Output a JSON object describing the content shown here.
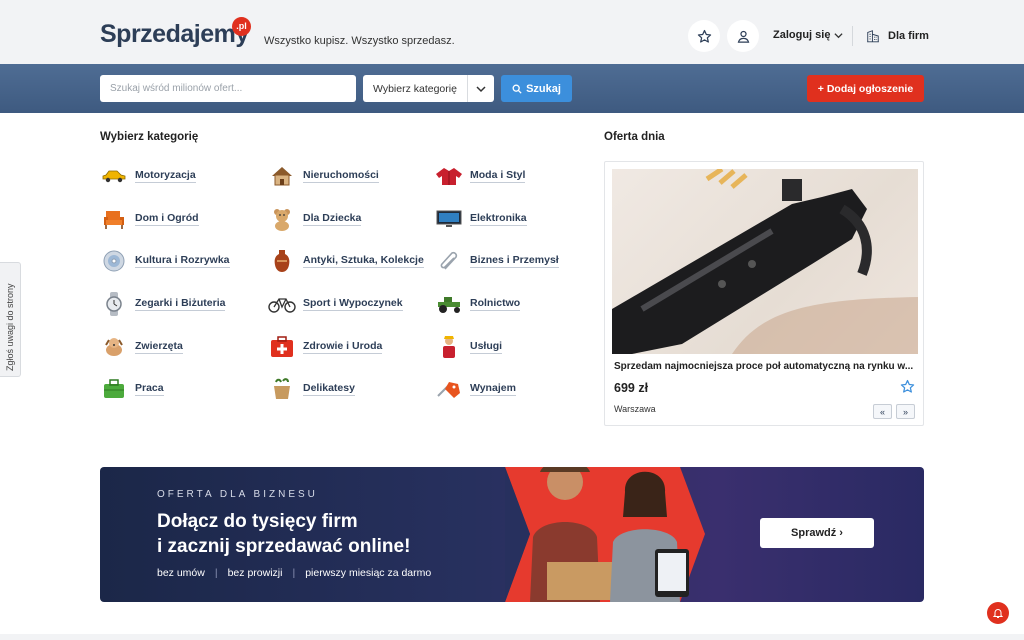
{
  "header": {
    "logo_text": "Sprzedajemy",
    "logo_badge": ".pl",
    "tagline": "Wszystko kupisz. Wszystko sprzedasz.",
    "login_label": "Zaloguj się",
    "firms_label": "Dla firm"
  },
  "search": {
    "placeholder": "Szukaj wśród milionów ofert...",
    "category_label": "Wybierz kategorię",
    "button_label": "Szukaj",
    "add_label": "+ Dodaj ogłoszenie"
  },
  "categories": {
    "title": "Wybierz kategorię",
    "items": [
      {
        "label": "Motoryzacja",
        "icon": "car-icon"
      },
      {
        "label": "Nieruchomości",
        "icon": "house-icon"
      },
      {
        "label": "Moda i Styl",
        "icon": "jacket-icon"
      },
      {
        "label": "Dom i Ogród",
        "icon": "armchair-icon"
      },
      {
        "label": "Dla Dziecka",
        "icon": "teddy-bear-icon"
      },
      {
        "label": "Elektronika",
        "icon": "tv-icon"
      },
      {
        "label": "Kultura i Rozrywka",
        "icon": "disc-icon"
      },
      {
        "label": "Antyki, Sztuka, Kolekcje",
        "icon": "vase-icon"
      },
      {
        "label": "Biznes i Przemysł",
        "icon": "paperclip-icon"
      },
      {
        "label": "Zegarki i Biżuteria",
        "icon": "watch-icon"
      },
      {
        "label": "Sport i Wypoczynek",
        "icon": "bicycle-icon"
      },
      {
        "label": "Rolnictwo",
        "icon": "tractor-icon"
      },
      {
        "label": "Zwierzęta",
        "icon": "dog-icon"
      },
      {
        "label": "Zdrowie i Uroda",
        "icon": "first-aid-icon"
      },
      {
        "label": "Usługi",
        "icon": "worker-icon"
      },
      {
        "label": "Praca",
        "icon": "briefcase-icon"
      },
      {
        "label": "Delikatesy",
        "icon": "grocery-bag-icon"
      },
      {
        "label": "Wynajem",
        "icon": "key-tag-icon"
      }
    ]
  },
  "offer": {
    "section_title": "Oferta dnia",
    "title": "Sprzedam najmocniejsza proce poł automatyczną na rynku w...",
    "price": "699 zł",
    "location": "Warszawa",
    "prev_label": "«",
    "next_label": "»"
  },
  "banner": {
    "eyebrow": "OFERTA DLA BIZNESU",
    "headline_1": "Dołącz do tysięcy firm",
    "headline_2": "i zacznij sprzedawać online!",
    "perks": [
      "bez umów",
      "bez prowizji",
      "pierwszy miesiąc za darmo"
    ],
    "button_label": "Sprawdź ›"
  },
  "feedback": {
    "label": "Zgłoś uwagi do strony"
  },
  "colors": {
    "brand_red": "#e0301e",
    "brand_navy": "#2d3e57",
    "search_blue": "#3c8fdc"
  }
}
